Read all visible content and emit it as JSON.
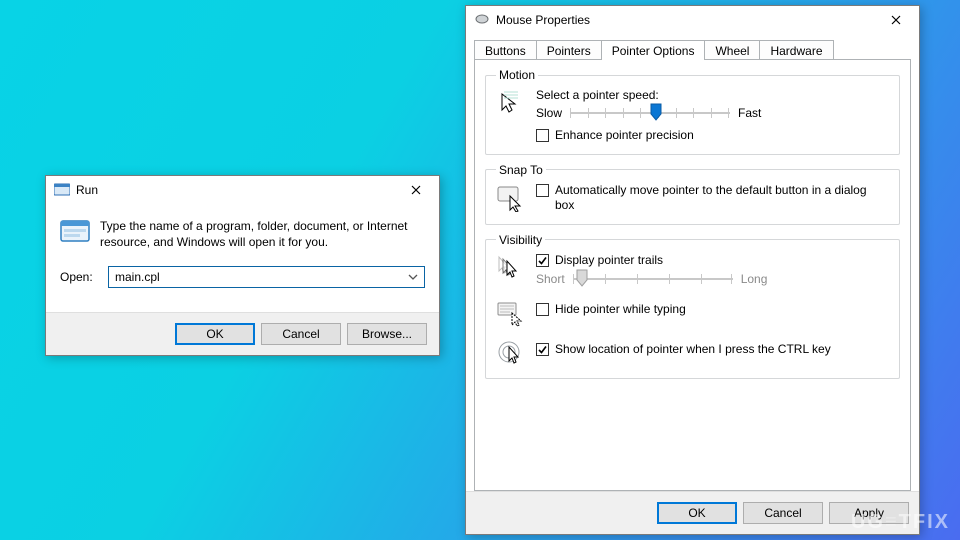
{
  "run": {
    "title": "Run",
    "description": "Type the name of a program, folder, document, or Internet resource, and Windows will open it for you.",
    "open_label": "Open:",
    "input_value": "main.cpl",
    "buttons": {
      "ok": "OK",
      "cancel": "Cancel",
      "browse": "Browse..."
    }
  },
  "mouse": {
    "title": "Mouse Properties",
    "tabs": [
      "Buttons",
      "Pointers",
      "Pointer Options",
      "Wheel",
      "Hardware"
    ],
    "active_tab": "Pointer Options",
    "motion": {
      "legend": "Motion",
      "speed_label": "Select a pointer speed:",
      "slow": "Slow",
      "fast": "Fast",
      "enhance": "Enhance pointer precision",
      "enhance_checked": false
    },
    "snap": {
      "legend": "Snap To",
      "label": "Automatically move pointer to the default button in a dialog box",
      "checked": false
    },
    "visibility": {
      "legend": "Visibility",
      "trails_label": "Display pointer trails",
      "trails_checked": true,
      "short": "Short",
      "long": "Long",
      "hide_label": "Hide pointer while typing",
      "hide_checked": false,
      "ctrl_label": "Show location of pointer when I press the CTRL key",
      "ctrl_checked": true
    },
    "buttons": {
      "ok": "OK",
      "cancel": "Cancel",
      "apply": "Apply"
    }
  },
  "watermark": "UG   TFIX"
}
